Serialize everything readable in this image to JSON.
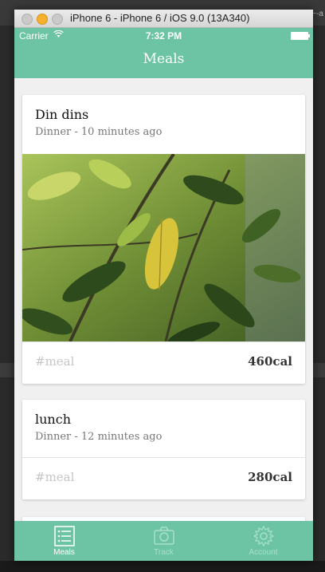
{
  "simulator": {
    "title": "iPhone 6 - iPhone 6 / iOS 9.0 (13A340)"
  },
  "status_bar": {
    "carrier": "Carrier",
    "time": "7:32 PM"
  },
  "nav": {
    "title": "Meals"
  },
  "meals": [
    {
      "title": "Din dins",
      "subtitle": "Dinner - 10 minutes ago",
      "tag": "#meal",
      "calories": "460cal",
      "has_photo": true
    },
    {
      "title": "lunch",
      "subtitle": "Dinner - 12 minutes ago",
      "tag": "#meal",
      "calories": "280cal",
      "has_photo": false
    }
  ],
  "tabs": [
    {
      "label": "Meals",
      "icon": "list-icon",
      "active": true
    },
    {
      "label": "Track",
      "icon": "camera-icon",
      "active": false
    },
    {
      "label": "Account",
      "icon": "gear-icon",
      "active": false
    }
  ],
  "colors": {
    "accent": "#6cc4a4",
    "tab_inactive": "#a8e0cc"
  }
}
